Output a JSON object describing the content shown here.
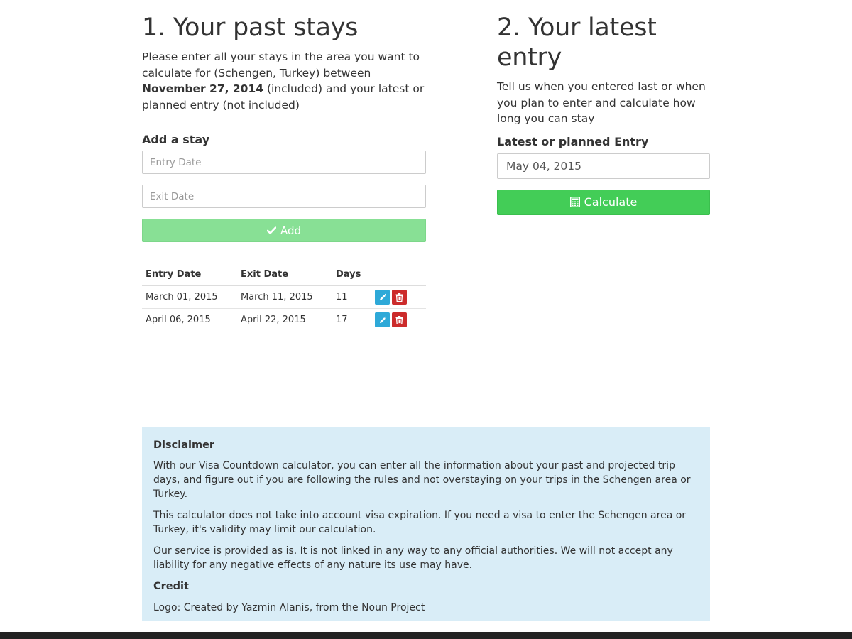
{
  "past_stays": {
    "heading": "1. Your past stays",
    "intro_before": "Please enter all your stays in the area you want to calculate for (Schengen, Turkey) between ",
    "intro_date": "November 27, 2014",
    "intro_after": " (included) and your latest or planned entry (not included)",
    "add_label": "Add a stay",
    "entry_placeholder": "Entry Date",
    "exit_placeholder": "Exit Date",
    "add_button": "Add",
    "table": {
      "headers": [
        "Entry Date",
        "Exit Date",
        "Days"
      ],
      "rows": [
        {
          "entry": "March 01, 2015",
          "exit": "March 11, 2015",
          "days": "11"
        },
        {
          "entry": "April 06, 2015",
          "exit": "April 22, 2015",
          "days": "17"
        }
      ]
    }
  },
  "latest_entry": {
    "heading": "2. Your latest entry",
    "intro": "Tell us when you entered last or when you plan to enter and calculate how long you can stay",
    "field_label": "Latest or planned Entry",
    "field_value": "May 04, 2015",
    "calculate_button": "Calculate"
  },
  "disclaimer": {
    "title": "Disclaimer",
    "paragraphs": [
      "With our Visa Countdown calculator, you can enter all the information about your past and projected trip days, and figure out if you are following the rules and not overstaying on your trips in the Schengen area or Turkey.",
      "This calculator does not take into account visa expiration. If you need a visa to enter the Schengen area or Turkey, it's validity may limit our calculation.",
      "Our service is provided as is. It is not linked in any way to any official authorities. We will not accept any liability for any negative effects of any nature its use may have."
    ],
    "credit_title": "Credit",
    "credit_text": "Logo: Created by Yazmin Alanis, from the Noun Project"
  },
  "icons": {
    "add": "check-icon",
    "calculate": "calculator-icon",
    "edit": "pencil-icon",
    "delete": "trash-icon"
  },
  "colors": {
    "add_button": "#88e095",
    "calculate_button": "#43cd57",
    "edit_button": "#2ea9d8",
    "delete_button": "#cc2b2b",
    "disclaimer_bg": "#d9edf7",
    "footer": "#222222"
  }
}
